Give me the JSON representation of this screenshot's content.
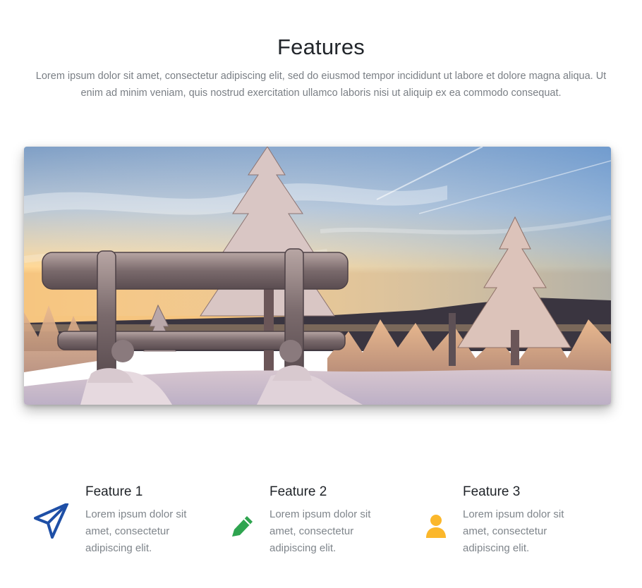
{
  "section": {
    "title": "Features",
    "description": "Lorem ipsum dolor sit amet, consectetur adipiscing elit, sed do eiusmod tempor incididunt ut labore et dolore magna aliqua. Ut enim ad minim veniam, quis nostrud exercitation ullamco laboris nisi ut aliquip ex ea commodo consequat."
  },
  "hero_image": {
    "subject": "snow-covered bench and trees at sunset"
  },
  "features": [
    {
      "title": "Feature 1",
      "text": "Lorem ipsum dolor sit amet, consectetur adipiscing elit.",
      "icon": "paper-plane-icon",
      "color": "#1e4fa6"
    },
    {
      "title": "Feature 2",
      "text": "Lorem ipsum dolor sit amet, consectetur adipiscing elit.",
      "icon": "pencil-icon",
      "color": "#2ea44f"
    },
    {
      "title": "Feature 3",
      "text": "Lorem ipsum dolor sit amet, consectetur adipiscing elit.",
      "icon": "user-icon",
      "color": "#fbb72b"
    }
  ]
}
